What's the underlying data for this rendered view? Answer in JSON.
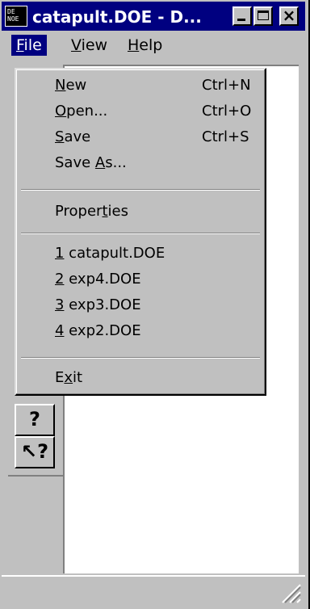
{
  "window": {
    "title": "catapult.DOE - D...",
    "app_icon_text": "DE\nNOE"
  },
  "menubar": {
    "file": {
      "pre": "",
      "u": "F",
      "post": "ile"
    },
    "view": {
      "pre": "",
      "u": "V",
      "post": "iew"
    },
    "help": {
      "pre": "",
      "u": "H",
      "post": "elp"
    }
  },
  "file_menu": {
    "new": {
      "pre": "",
      "u": "N",
      "post": "ew",
      "shortcut": "Ctrl+N"
    },
    "open": {
      "pre": "",
      "u": "O",
      "post": "pen...",
      "shortcut": "Ctrl+O"
    },
    "save": {
      "pre": "",
      "u": "S",
      "post": "ave",
      "shortcut": "Ctrl+S"
    },
    "save_as": {
      "pre": "Save ",
      "u": "A",
      "post": "s..."
    },
    "properties": {
      "pre": "Proper",
      "u": "t",
      "post": "ies"
    },
    "recent": [
      {
        "u": "1",
        "post": " catapult.DOE"
      },
      {
        "u": "2",
        "post": " exp4.DOE"
      },
      {
        "u": "3",
        "post": " exp3.DOE"
      },
      {
        "u": "4",
        "post": " exp2.DOE"
      }
    ],
    "exit": {
      "pre": "E",
      "u": "x",
      "post": "it"
    }
  },
  "toolbar": {
    "tool1_glyph": "?",
    "tool2_glyph": "↖?"
  }
}
